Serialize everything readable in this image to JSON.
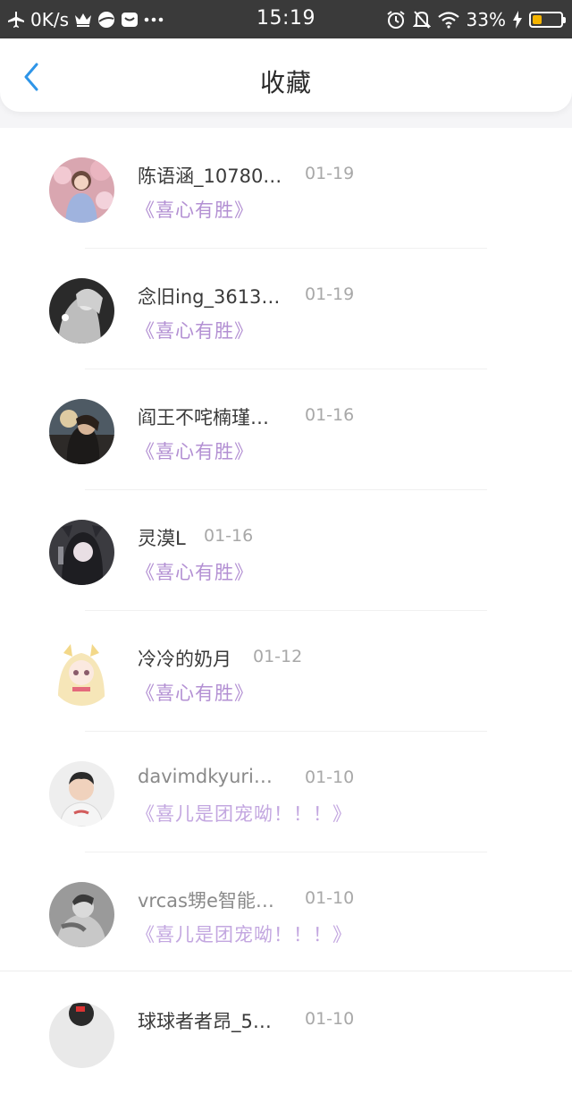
{
  "status_bar": {
    "net_speed": "0K/s",
    "time": "15:19",
    "battery": "33%",
    "battery_level": 0.33,
    "icons": [
      "airplane-icon",
      "crown-icon",
      "ball-icon",
      "message-icon",
      "more-dots-icon",
      "alarm-icon",
      "bell-off-icon",
      "wifi-icon",
      "charging-icon",
      "battery-icon"
    ],
    "accent": "#f4b400"
  },
  "header": {
    "title": "收藏",
    "back_icon": "chevron-left-icon",
    "accent": "#2e95e8"
  },
  "list": {
    "items": [
      {
        "name": "陈语涵_10780…",
        "date": "01-19",
        "title": "《喜心有胜》"
      },
      {
        "name": "念旧ing_3613…",
        "date": "01-19",
        "title": "《喜心有胜》"
      },
      {
        "name": "阎王不咤楠瑾…",
        "date": "01-16",
        "title": "《喜心有胜》"
      },
      {
        "name": "灵漠L",
        "date": "01-16",
        "title": "《喜心有胜》"
      },
      {
        "name": "冷冷的奶月",
        "date": "01-12",
        "title": "《喜心有胜》"
      },
      {
        "name": "davimdkyuri…",
        "date": "01-10",
        "title": "《喜儿是团宠呦！！！》"
      },
      {
        "name": "vrcas甥e智能…",
        "date": "01-10",
        "title": "《喜儿是团宠呦！！！》"
      },
      {
        "name": "球球者者昂_5…",
        "date": "01-10",
        "title": ""
      }
    ],
    "title_color": "#b390d3"
  }
}
